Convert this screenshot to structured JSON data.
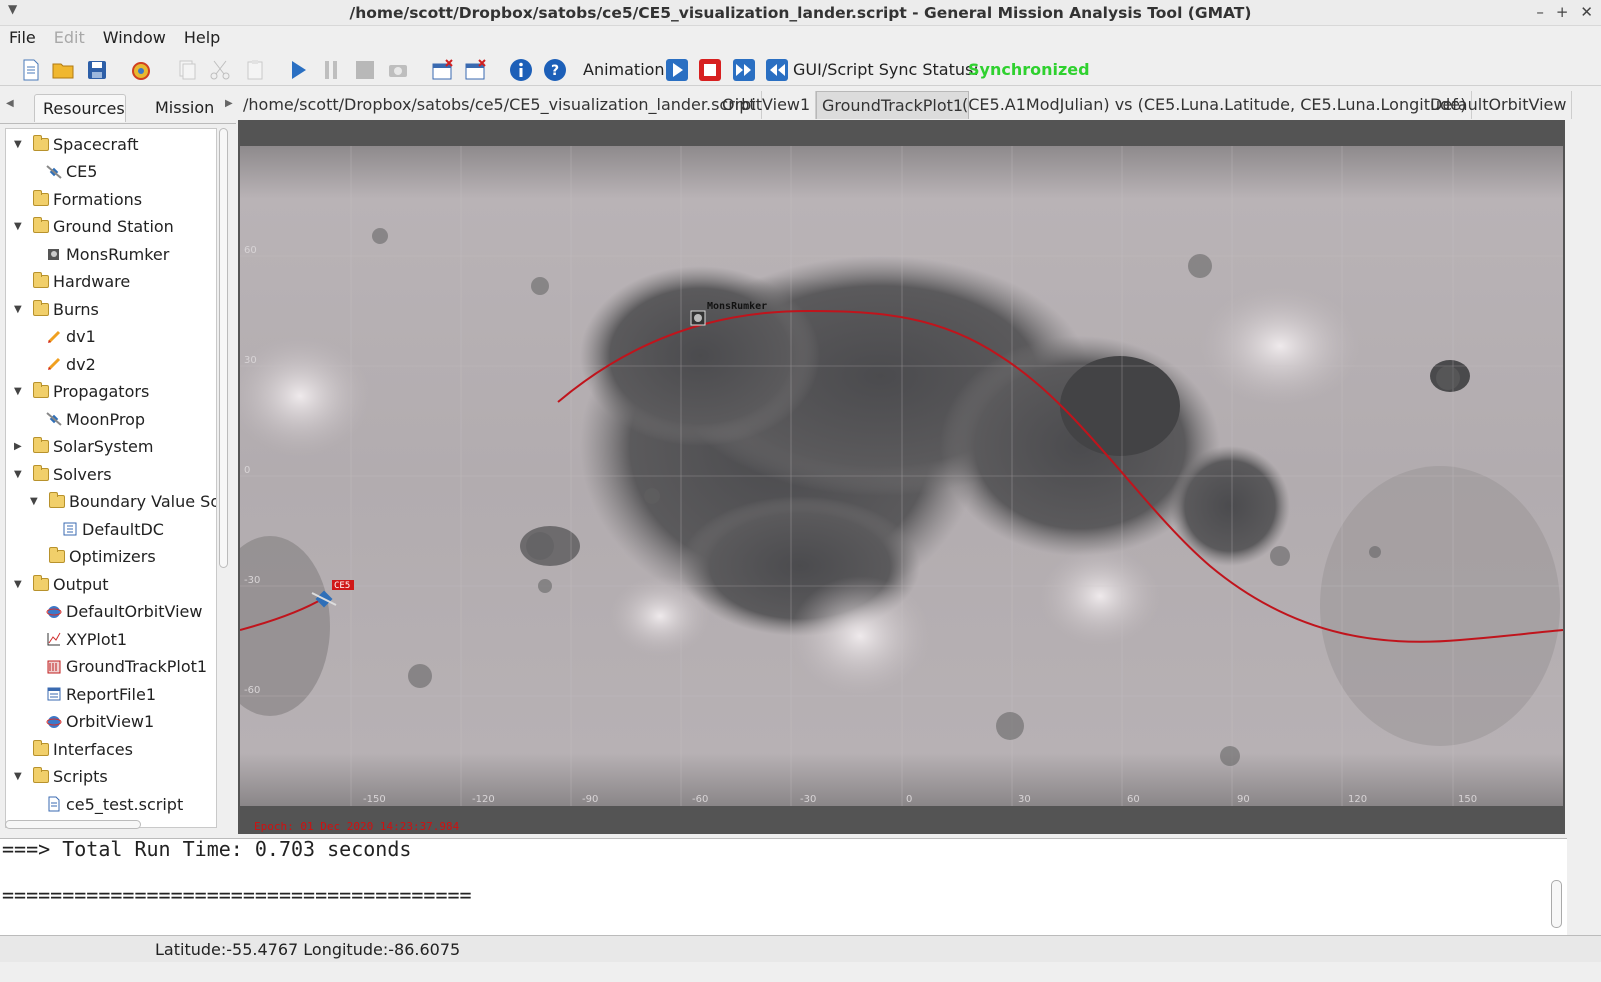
{
  "window": {
    "title": "/home/scott/Dropbox/satobs/ce5/CE5_visualization_lander.script - General Mission Analysis Tool (GMAT)"
  },
  "menu": [
    "File",
    "Edit",
    "Window",
    "Help"
  ],
  "toolbar": {
    "animation_label": "Animation",
    "sync_label": "GUI/Script Sync Status:",
    "sync_status": "Synchronized",
    "sync_color": "#2fd12f"
  },
  "left_tabs": [
    "Resources",
    "Mission"
  ],
  "tree": [
    {
      "label": "Spacecraft"
    },
    {
      "label": "CE5"
    },
    {
      "label": "Formations"
    },
    {
      "label": "Ground Station"
    },
    {
      "label": "MonsRumker"
    },
    {
      "label": "Hardware"
    },
    {
      "label": "Burns"
    },
    {
      "label": "dv1"
    },
    {
      "label": "dv2"
    },
    {
      "label": "Propagators"
    },
    {
      "label": "MoonProp"
    },
    {
      "label": "SolarSystem"
    },
    {
      "label": "Solvers"
    },
    {
      "label": "Boundary Value Solv"
    },
    {
      "label": "DefaultDC"
    },
    {
      "label": "Optimizers"
    },
    {
      "label": "Output"
    },
    {
      "label": "DefaultOrbitView"
    },
    {
      "label": "XYPlot1"
    },
    {
      "label": "GroundTrackPlot1"
    },
    {
      "label": "ReportFile1"
    },
    {
      "label": "OrbitView1"
    },
    {
      "label": "Interfaces"
    },
    {
      "label": "Scripts"
    },
    {
      "label": "ce5_test.script"
    }
  ],
  "right_tabs": [
    "/home/scott/Dropbox/satobs/ce5/CE5_visualization_lander.script",
    "OrbitView1",
    "GroundTrackPlot1",
    "(CE5.A1ModJulian) vs (CE5.Luna.Latitude, CE5.Luna.Longitude)",
    "DefaultOrbitView"
  ],
  "plot": {
    "station_label": "MonsRumker",
    "spacecraft_label": "CE5",
    "lon_ticks": [
      "-150",
      "-120",
      "-90",
      "-60",
      "-30",
      "0",
      "30",
      "60",
      "90",
      "120",
      "150"
    ],
    "lat_ticks": [
      "60",
      "30",
      "0",
      "-30",
      "-60"
    ],
    "epoch": "Epoch: 01 Dec 2020 14:23:37.984",
    "track_color": "#c0141c"
  },
  "console": {
    "line1": "===> Total Run Time: 0.703 seconds",
    "line2": "======================================="
  },
  "status": {
    "text": "Latitude:-55.4767  Longitude:-86.6075"
  }
}
